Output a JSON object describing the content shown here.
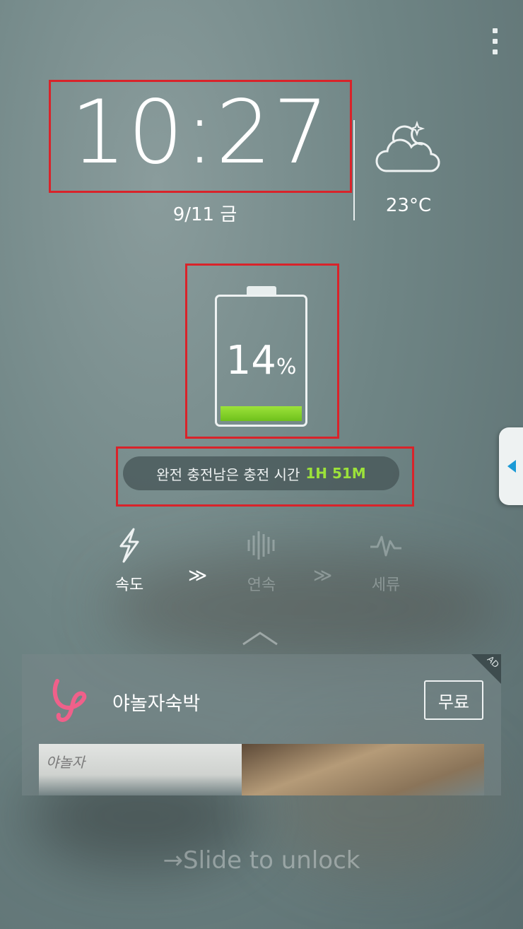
{
  "clock": {
    "time": "10:27",
    "date": "9/11 금"
  },
  "weather": {
    "icon": "cloud-moon-icon",
    "temperature": "23°C"
  },
  "battery": {
    "percent_value": "14",
    "percent_symbol": "%",
    "level": 0.14,
    "fill_color": "#8ad42c"
  },
  "charging": {
    "label": "완전 충전남은 충전 시간",
    "remaining": "1H 51M"
  },
  "modes": [
    {
      "label": "속도",
      "icon": "lightning-icon",
      "active": true
    },
    {
      "label": "연속",
      "icon": "sound-wave-icon",
      "active": false
    },
    {
      "label": "세류",
      "icon": "pulse-icon",
      "active": false
    }
  ],
  "chevron": "≫",
  "ad": {
    "badge": "AD",
    "app_name": "야놀자숙박",
    "button_label": "무료",
    "banner_text": "야놀자"
  },
  "unlock": {
    "text": "Slide to unlock",
    "arrow": "→"
  },
  "colors": {
    "accent_green": "#9ce23a",
    "highlight_red": "#d9232a",
    "tab_arrow_blue": "#1b9ad6"
  }
}
